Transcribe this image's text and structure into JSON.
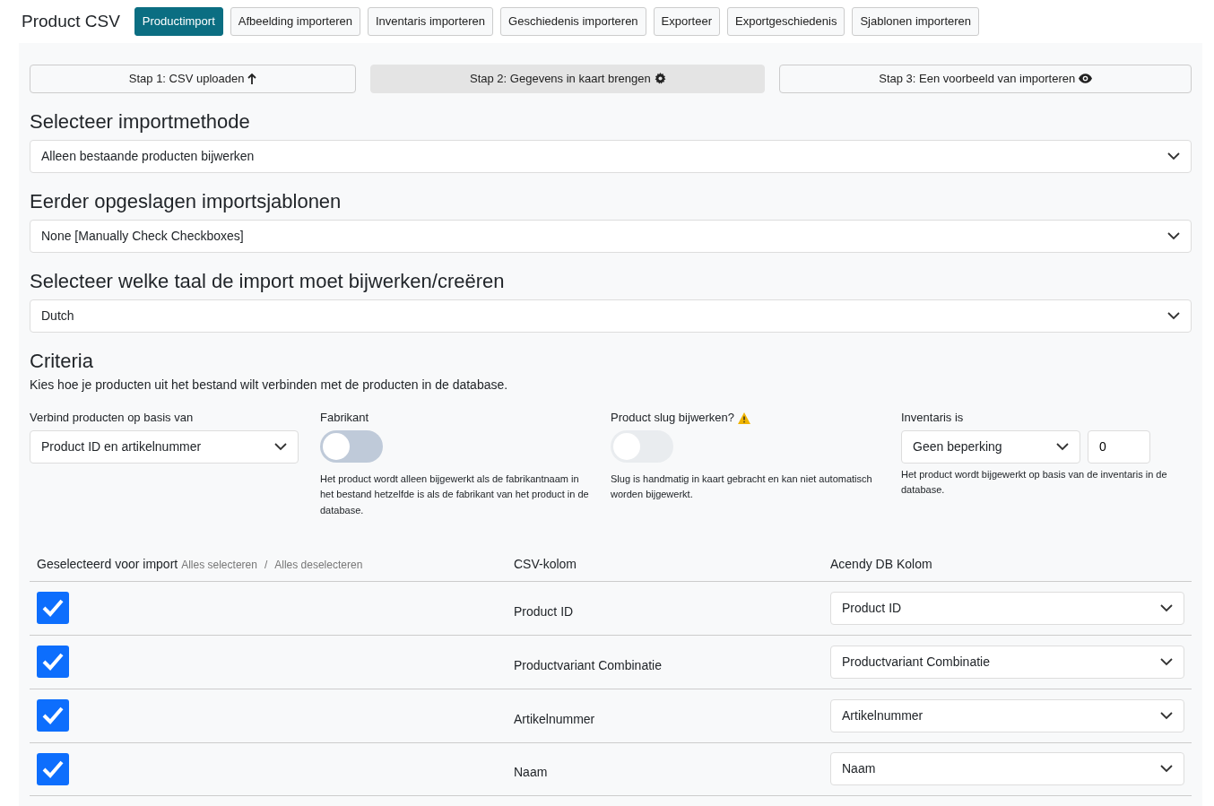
{
  "title": "Product CSV",
  "tabs": [
    {
      "label": "Productimport",
      "selected": true
    },
    {
      "label": "Afbeelding importeren",
      "selected": false
    },
    {
      "label": "Inventaris importeren",
      "selected": false
    },
    {
      "label": "Geschiedenis importeren",
      "selected": false
    },
    {
      "label": "Exporteer",
      "selected": false
    },
    {
      "label": "Exportgeschiedenis",
      "selected": false
    },
    {
      "label": "Sjablonen importeren",
      "selected": false
    }
  ],
  "steps": [
    {
      "label": "Stap 1: CSV uploaden",
      "selected": false
    },
    {
      "label": "Stap 2: Gegevens in kaart brengen",
      "selected": true
    },
    {
      "label": "Stap 3: Een voorbeeld van importeren",
      "selected": false
    }
  ],
  "sections": [
    {
      "heading": "Selecteer importmethode",
      "value": "Alleen bestaande producten bijwerken"
    },
    {
      "heading": "Eerder opgeslagen importsjablonen",
      "value": "None [Manually Check Checkboxes]"
    },
    {
      "heading": "Selecteer welke taal de import moet bijwerken/creëren",
      "value": "Dutch"
    }
  ],
  "criteria": {
    "heading": "Criteria",
    "description": "Kies hoe je producten uit het bestand wilt verbinden met de producten in de database.",
    "fields": [
      {
        "kind": "select",
        "label": "Verbind producten op basis van",
        "value": "Product ID en artikelnummer"
      },
      {
        "kind": "toggle",
        "label": "Fabrikant",
        "on": false,
        "disabled": false,
        "help": "Het product wordt alleen bijgewerkt als de fabrikantnaam in het bestand hetzelfde is als de fabrikant van het product in de database."
      },
      {
        "kind": "toggle",
        "label": "Product slug bijwerken?",
        "warning": true,
        "on": false,
        "disabled": true,
        "help": "Slug is handmatig in kaart gebracht en kan niet automatisch worden bijgewerkt."
      },
      {
        "kind": "select-number",
        "label": "Inventaris is",
        "value": "Geen beperking",
        "number": "0",
        "help": "Het product wordt bijgewerkt op basis van de inventaris in de database."
      }
    ]
  },
  "mapping": {
    "columns": [
      "Geselecteerd voor import",
      "CSV-kolom",
      "Acendy DB Kolom"
    ],
    "select_all": "Alles selecteren",
    "separator": "/",
    "deselect_all": "Alles deselecteren",
    "rows": [
      {
        "checked": true,
        "csv": "Product ID",
        "db": "Product ID"
      },
      {
        "checked": true,
        "csv": "Productvariant Combinatie",
        "db": "Productvariant Combinatie"
      },
      {
        "checked": true,
        "csv": "Artikelnummer",
        "db": "Artikelnummer"
      },
      {
        "checked": true,
        "csv": "Naam",
        "db": "Naam"
      }
    ]
  }
}
